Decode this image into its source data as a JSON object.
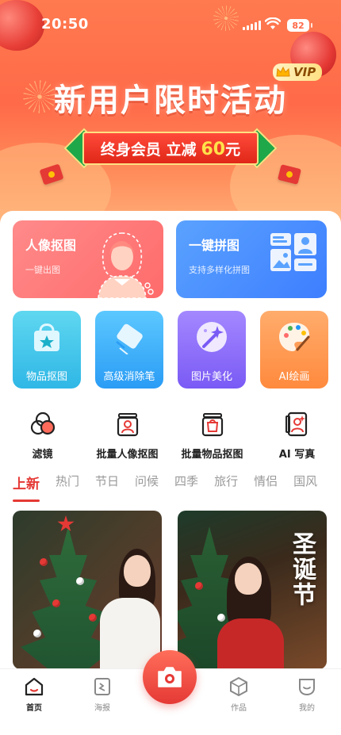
{
  "status_bar": {
    "time": "20:50",
    "battery": "82"
  },
  "banner": {
    "vip": "VIP",
    "title": "新用户限时活动",
    "promo_text": "终身会员 立减",
    "promo_amount": "60",
    "promo_unit": "元"
  },
  "features": [
    {
      "title": "人像抠图",
      "subtitle": "一键出图"
    },
    {
      "title": "一键拼图",
      "subtitle": "支持多样化拼图"
    }
  ],
  "tools": [
    {
      "label": "物品抠图",
      "icon": "bag-icon"
    },
    {
      "label": "高级消除笔",
      "icon": "eraser-icon"
    },
    {
      "label": "图片美化",
      "icon": "magic-wand-icon"
    },
    {
      "label": "AI绘画",
      "icon": "palette-icon"
    }
  ],
  "quick_actions": [
    {
      "label": "滤镜",
      "icon": "filter-icon"
    },
    {
      "label": "批量人像抠图",
      "icon": "batch-portrait-icon"
    },
    {
      "label": "批量物品抠图",
      "icon": "batch-bag-icon"
    },
    {
      "label": "AI 写真",
      "icon": "ai-portrait-icon"
    }
  ],
  "tabs": [
    "上新",
    "热门",
    "节日",
    "问候",
    "四季",
    "旅行",
    "情侣",
    "国风"
  ],
  "active_tab": "上新",
  "gallery": [
    {
      "caption": ""
    },
    {
      "caption": "圣诞节"
    }
  ],
  "bottom_nav": [
    {
      "label": "首页",
      "icon": "home-icon",
      "active": true
    },
    {
      "label": "海报",
      "icon": "poster-icon",
      "active": false
    },
    {
      "label": "作品",
      "icon": "works-icon",
      "active": false
    },
    {
      "label": "我的",
      "icon": "profile-icon",
      "active": false
    }
  ],
  "colors": {
    "accent": "#e53935",
    "banner": "#ff6a48"
  }
}
